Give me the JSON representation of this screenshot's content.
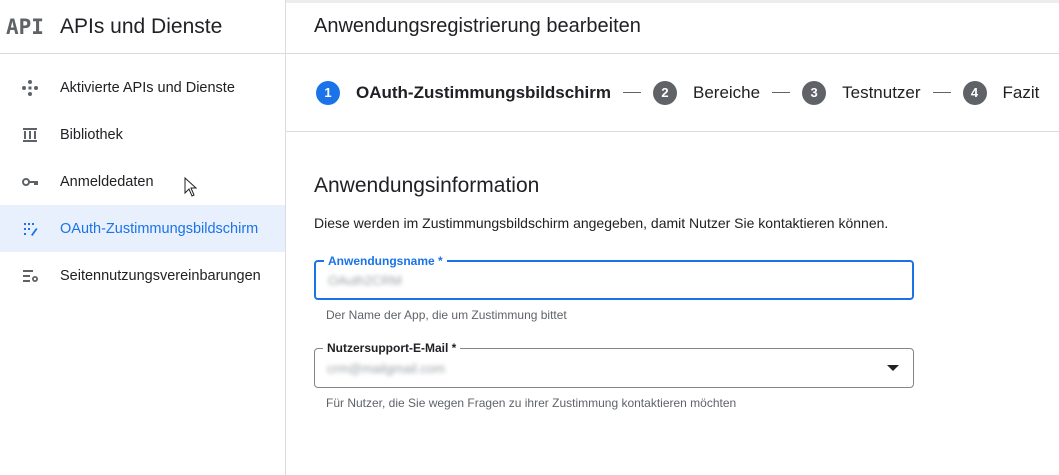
{
  "sidebar": {
    "logo": "API",
    "title": "APIs und Dienste",
    "items": [
      {
        "label": "Aktivierte APIs und Dienste",
        "icon": "apis-services-icon"
      },
      {
        "label": "Bibliothek",
        "icon": "library-icon"
      },
      {
        "label": "Anmeldedaten",
        "icon": "key-icon"
      },
      {
        "label": "OAuth-Zustimmungsbildschirm",
        "icon": "oauth-consent-icon",
        "active": true
      },
      {
        "label": "Seitennutzungsvereinbarungen",
        "icon": "settings-list-icon"
      }
    ]
  },
  "main": {
    "title": "Anwendungsregistrierung bearbeiten",
    "steps": [
      {
        "num": "1",
        "label": "OAuth-Zustimmungsbildschirm",
        "active": true
      },
      {
        "num": "2",
        "label": "Bereiche"
      },
      {
        "num": "3",
        "label": "Testnutzer"
      },
      {
        "num": "4",
        "label": "Fazit"
      }
    ],
    "section_title": "Anwendungsinformation",
    "description": "Diese werden im Zustimmungsbildschirm angegeben, damit Nutzer Sie kontaktieren können.",
    "fields": {
      "app_name": {
        "label": "Anwendungsname *",
        "value": "OAuth2CRM",
        "hint": "Der Name der App, die um Zustimmung bittet"
      },
      "support_email": {
        "label": "Nutzersupport-E-Mail *",
        "value": "crm@mailgmail.com",
        "hint": "Für Nutzer, die Sie wegen Fragen zu ihrer Zustimmung kontaktieren möchten"
      }
    }
  },
  "colors": {
    "accent": "#1a73e8",
    "active_bg": "#e8f0fe",
    "step_inactive": "#5f6368"
  }
}
